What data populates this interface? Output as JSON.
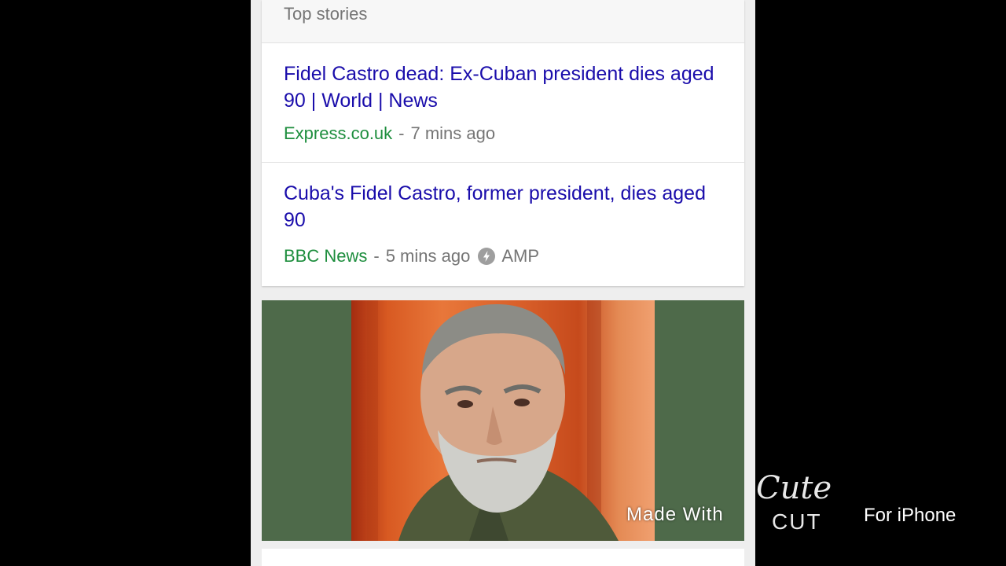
{
  "top_stories": {
    "header": "Top stories",
    "stories": [
      {
        "headline": "Fidel Castro dead: Ex-Cuban president dies aged 90 | World | News",
        "source": "Express.co.uk",
        "separator": "-",
        "time": "7 mins ago"
      },
      {
        "headline": "Cuba's Fidel Castro, former president, dies aged 90",
        "source": "BBC News",
        "separator": "-",
        "time": "5 mins ago",
        "badge_icon": "lightning-bolt-icon",
        "badge": "AMP"
      }
    ]
  },
  "image_card": {
    "background_color": "#4e6a4a",
    "photo_icon": "portrait-photo"
  },
  "watermark": {
    "made_with": "Made With",
    "cute": "Cute",
    "cut": "CUT",
    "for_iphone": "For iPhone"
  },
  "colors": {
    "link": "#1a0dab",
    "source": "#1e8e3e",
    "meta": "#757575"
  }
}
